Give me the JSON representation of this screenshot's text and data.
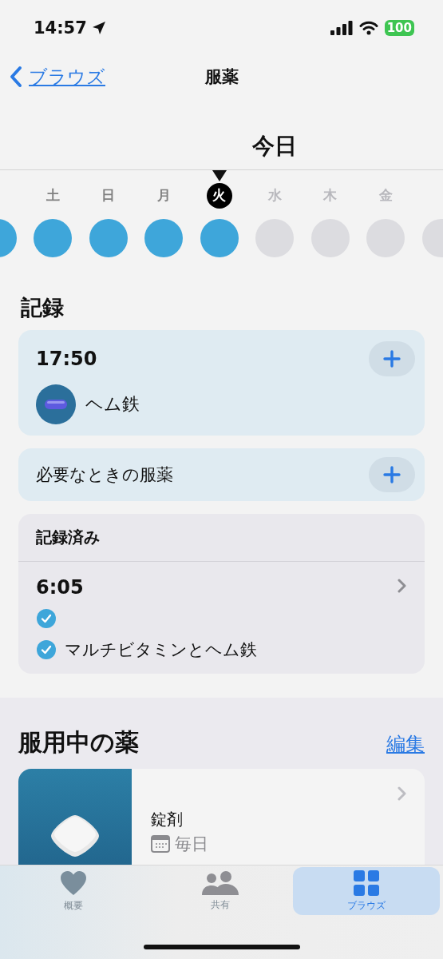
{
  "status_bar": {
    "time": "14:57",
    "battery": "100"
  },
  "nav": {
    "back": "ブラウズ",
    "title": "服薬"
  },
  "date_header": {
    "title": "今日"
  },
  "week": [
    {
      "done": true,
      "selected": false
    },
    {
      "label": "土",
      "done": true,
      "selected": false
    },
    {
      "label": "日",
      "done": true,
      "selected": false
    },
    {
      "label": "月",
      "done": true,
      "selected": false
    },
    {
      "label": "火",
      "done": true,
      "selected": true
    },
    {
      "label": "水",
      "done": false,
      "selected": false
    },
    {
      "label": "木",
      "done": false,
      "selected": false
    },
    {
      "label": "金",
      "done": false,
      "selected": false
    },
    {
      "done": false,
      "selected": false
    }
  ],
  "log": {
    "title": "記録",
    "scheduled": {
      "time": "17:50",
      "medications": [
        "ヘム鉄"
      ]
    },
    "as_needed": {
      "label": "必要なときの服薬"
    },
    "logged": {
      "title": "記録済み",
      "entries": [
        {
          "time": "6:05",
          "items": [
            {
              "checked": true
            },
            {
              "name": "マルチビタミンとヘム鉄",
              "checked": true
            }
          ]
        }
      ]
    }
  },
  "medications": {
    "title": "服用中の薬",
    "edit": "編集",
    "items": [
      {
        "form": "錠剤",
        "schedule": "毎日"
      }
    ]
  },
  "tab_bar": [
    {
      "label": "概要",
      "selected": false
    },
    {
      "label": "共有",
      "selected": false
    },
    {
      "label": "ブラウズ",
      "selected": true
    }
  ]
}
